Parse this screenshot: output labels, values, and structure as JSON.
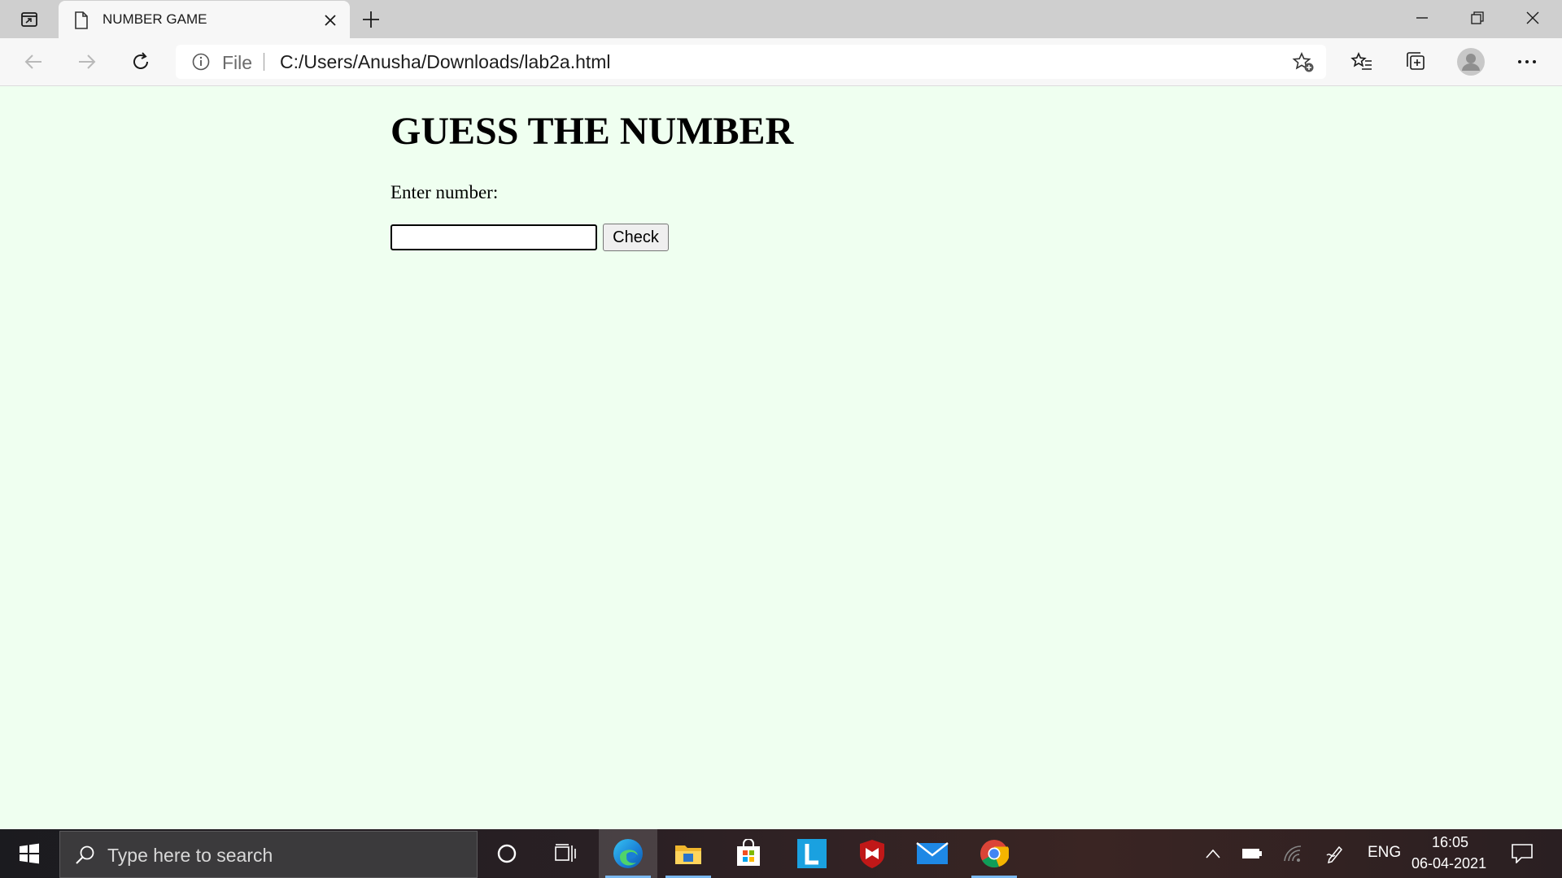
{
  "browser": {
    "tab_title": "NUMBER GAME",
    "address_scheme_label": "File",
    "address_url": "C:/Users/Anusha/Downloads/lab2a.html"
  },
  "page": {
    "heading": "GUESS THE NUMBER",
    "input_label": "Enter number:",
    "input_value": "",
    "check_button_label": "Check",
    "background_color": "#effff0"
  },
  "taskbar": {
    "search_placeholder": "Type here to search",
    "language": "ENG",
    "time": "16:05",
    "date": "06-04-2021",
    "apps": [
      "cortana",
      "task-view",
      "edge",
      "file-explorer",
      "microsoft-store",
      "l-app",
      "mcafee",
      "mail",
      "chrome"
    ]
  }
}
